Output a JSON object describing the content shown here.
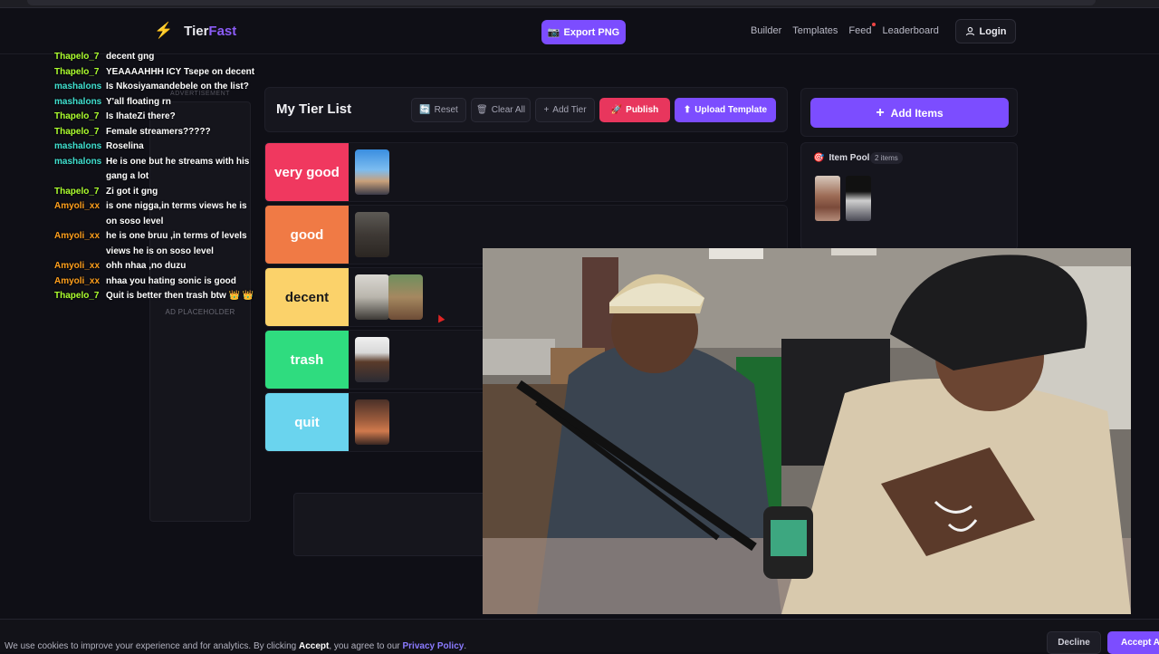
{
  "header": {
    "logo_part1": "Tier",
    "logo_part2": "Fast",
    "export_label": "Export PNG",
    "nav": [
      "Builder",
      "Templates",
      "Feed",
      "Leaderboard"
    ],
    "login_label": "Login"
  },
  "ads": {
    "top_label": "ADVERTISEMENT",
    "placeholder": "AD PLACEHOLDER"
  },
  "chat": [
    {
      "user": "Thapelo_7",
      "color": "#adff2f",
      "text": "decent gng"
    },
    {
      "user": "Thapelo_7",
      "color": "#adff2f",
      "text": "YEAAAAHHH ICY Tsepe on decent"
    },
    {
      "user": "mashalons",
      "color": "#40e0d0",
      "text": "Is Nkosiyamandebele on the list?"
    },
    {
      "user": "mashalons",
      "color": "#40e0d0",
      "text": "Y'all floating rn"
    },
    {
      "user": "Thapelo_7",
      "color": "#adff2f",
      "text": "Is IhateZi there?"
    },
    {
      "user": "Thapelo_7",
      "color": "#adff2f",
      "text": "Female streamers?????"
    },
    {
      "user": "mashalons",
      "color": "#40e0d0",
      "text": "Roselina"
    },
    {
      "user": "mashalons",
      "color": "#40e0d0",
      "text": "He is one but he streams with his gang a lot"
    },
    {
      "user": "Thapelo_7",
      "color": "#adff2f",
      "text": "Zi got it gng"
    },
    {
      "user": "Amyoli_xx",
      "color": "#ff9f1c",
      "text": "is one nigga,in terms views he is on soso level"
    },
    {
      "user": "Amyoli_xx",
      "color": "#ff9f1c",
      "text": "he is one bruu ,in terms of levels views he is on soso level"
    },
    {
      "user": "Amyoli_xx",
      "color": "#ff9f1c",
      "text": "ohh nhaa ,no duzu"
    },
    {
      "user": "Amyoli_xx",
      "color": "#ff9f1c",
      "text": "nhaa you hating sonic is good"
    },
    {
      "user": "Thapelo_7",
      "color": "#adff2f",
      "text": "Quit is better then trash btw 👑 👑"
    }
  ],
  "tierlist": {
    "title": "My Tier List",
    "reset": "Reset",
    "clear_all": "Clear All",
    "add_tier": "Add Tier",
    "publish": "Publish",
    "upload": "Upload Template",
    "tiers": [
      {
        "label": "very good",
        "color": "#f0385f",
        "items": 1
      },
      {
        "label": "good",
        "color": "#f07a45",
        "items": 1
      },
      {
        "label": "decent",
        "color": "#fbd26a",
        "items": 2
      },
      {
        "label": "trash",
        "color": "#2fdc7f",
        "items": 1
      },
      {
        "label": "quit",
        "color": "#6ad4ee",
        "items": 1
      }
    ]
  },
  "right": {
    "add_items": "Add Items",
    "pool_title": "Item Pool",
    "pool_count": "2 items"
  },
  "cookie": {
    "text_a": "We use cookies to improve your experience and for analytics. By clicking ",
    "accept_word": "Accept",
    "text_b": ", you agree to our ",
    "privacy": "Privacy Policy",
    "text_c": ".",
    "decline": "Decline",
    "accept": "Accept All"
  }
}
